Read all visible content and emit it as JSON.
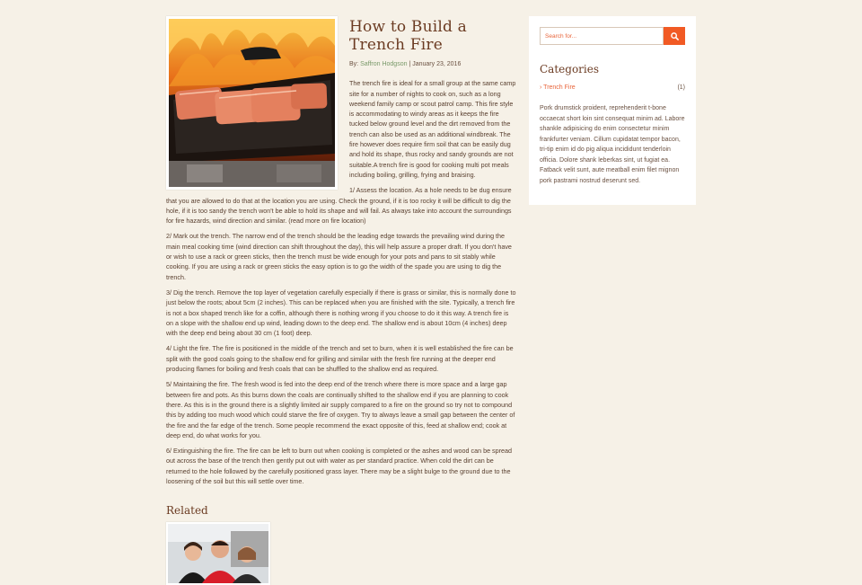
{
  "article": {
    "title": "How to Build a Trench Fire",
    "by_label": "By:",
    "author": "Saffron Hodgson",
    "separator": "|",
    "date": "January 23, 2016",
    "paragraphs": [
      "The trench fire is ideal for a small group at the same camp site for a number of nights to cook on, such as a long weekend family camp or scout patrol camp. This fire style is accommodating to windy areas as it keeps the fire tucked below ground level and the dirt removed from the trench can also be used as an additional windbreak. The fire however does require firm soil that can be easily dug and hold its shape, thus rocky and sandy grounds are not suitable.A trench fire is good for cooking multi pot meals including boiling, grilling, frying and braising.",
      "1/ Assess the location. As a hole needs to be dug ensure that you are allowed to do that at the location you are using. Check the ground, if it is too rocky it will be difficult to dig the hole, if it is too sandy the trench won't be able to hold its shape and will fail. As always take into account the surroundings for fire hazards, wind direction and similar. (read more on fire location)",
      "2/ Mark out the trench. The narrow end of the trench should be the leading edge towards the prevailing wind during the main meal cooking time (wind direction can shift throughout the day), this will help assure a proper draft. If you don't have or wish to use a rack or green sticks, then the trench must be wide enough for your pots and pans to sit stably while cooking. If you are using a rack or green sticks the easy option is to go the width of the spade you are using to dig the trench.",
      "3/ Dig the trench. Remove the top layer of vegetation carefully especially if there is grass or similar, this is normally done to just below the roots; about 5cm (2 inches). This can be replaced when you are finished with the site. Typically, a trench fire is not a box shaped trench like for a coffin, although there is nothing wrong if you choose to do it this way. A trench fire is on a slope with the shallow end up wind, leading down to the deep end. The shallow end is about 10cm (4 inches) deep with the deep end being about 30 cm (1 foot) deep.",
      "4/ Light the fire. The fire is positioned in the middle of the trench and set to burn, when it is well established the fire can be split with the good coals going to the shallow end for grilling and similar with the fresh fire running at the deeper end producing flames for boiling and fresh coals that can be shuffled to the shallow end as required.",
      "5/ Maintaining the fire. The fresh wood is fed into the deep end of the trench where there is more space and a large gap between fire and pots. As this burns down the coals are continually shifted to the shallow end if you are planning to cook there. As this is in the ground there is a slightly limited air supply compared to a fire on the ground so try not to compound this by adding too much wood which could starve the fire of oxygen. Try to always leave a small gap between the center of the fire and the far edge of the trench. Some people recommend the exact opposite of this, feed at shallow end; cook at deep end, do what works for you.",
      "6/ Extinguishing the fire. The fire can be left to burn out when cooking is completed or the ashes and wood can be spread out across the base of the trench then gently put out with water as per standard practice. When cold the dirt can be returned to the hole followed by the carefully positioned grass layer. There may be a slight bulge to the ground due to the loosening of the soil but this will settle over time."
    ],
    "related_title": "Related"
  },
  "sidebar": {
    "search_placeholder": "Search for...",
    "categories_title": "Categories",
    "categories": [
      {
        "label": "Trench Fire",
        "count": "(1)"
      }
    ],
    "text": "Pork drumstick proident, reprehenderit t-bone occaecat short loin sint consequat minim ad. Labore shankle adipisicing do enim consectetur minim frankfurter veniam. Cillum cupidatat tempor bacon, tri-tip enim id do pig aliqua incididunt tenderloin officia. Dolore shank leberkas sint, ut fugiat ea. Fatback velit sunt, aute meatball enim filet mignon pork pastrami nostrud deserunt sed."
  },
  "colors": {
    "background": "#f6f1e7",
    "accent": "#f15a24",
    "heading": "#6b3b22",
    "author_link": "#7a9a6a"
  },
  "icons": {
    "search_button": "search-icon",
    "category_bullet": "chevron-right-icon"
  }
}
